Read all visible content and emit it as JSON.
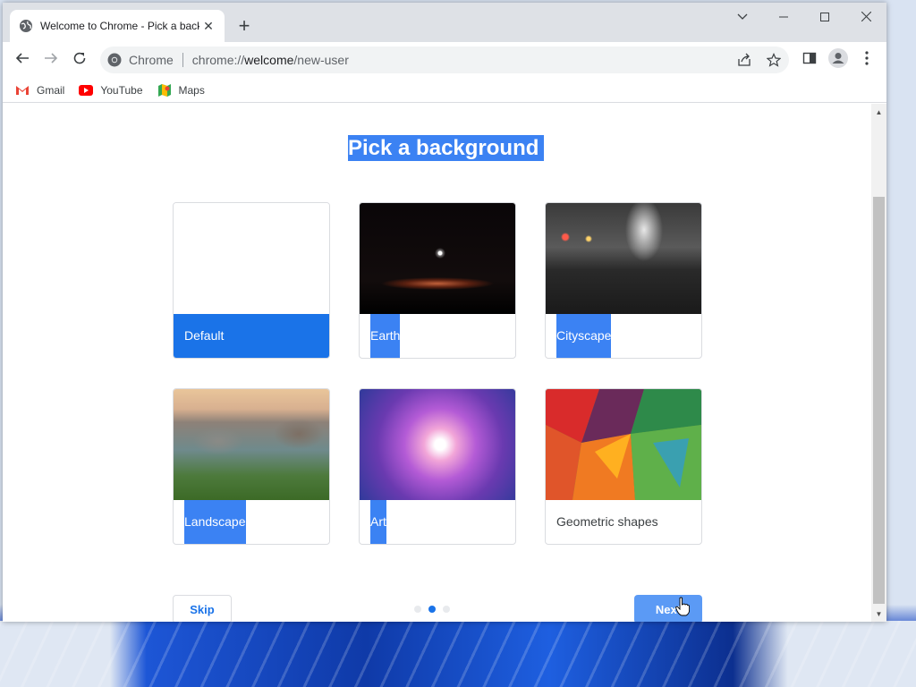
{
  "tab": {
    "title": "Welcome to Chrome - Pick a background",
    "close": "✕",
    "new_tab": "+"
  },
  "window_controls": {
    "dropdown": "⌄",
    "minimize": "—",
    "maximize": "☐",
    "close": "✕"
  },
  "omnibox": {
    "site_name": "Chrome",
    "url_prefix": "chrome://",
    "url_host": "welcome",
    "url_path": "/new-user"
  },
  "bookmarks": [
    {
      "label": "Gmail",
      "icon": "gmail-icon"
    },
    {
      "label": "YouTube",
      "icon": "youtube-icon"
    },
    {
      "label": "Maps",
      "icon": "maps-icon"
    }
  ],
  "page": {
    "heading": "Pick a background",
    "backgrounds": [
      {
        "label": "Default",
        "selected": true
      },
      {
        "label": "Earth",
        "selected": false
      },
      {
        "label": "Cityscape",
        "selected": false
      },
      {
        "label": "Landscape",
        "selected": false
      },
      {
        "label": "Art",
        "selected": false
      },
      {
        "label": "Geometric shapes",
        "selected": false
      }
    ],
    "skip_label": "Skip",
    "next_label": "Next",
    "pagination": {
      "total": 3,
      "current": 2
    }
  },
  "colors": {
    "accent": "#1a73e8",
    "highlight": "#3b82f3"
  }
}
